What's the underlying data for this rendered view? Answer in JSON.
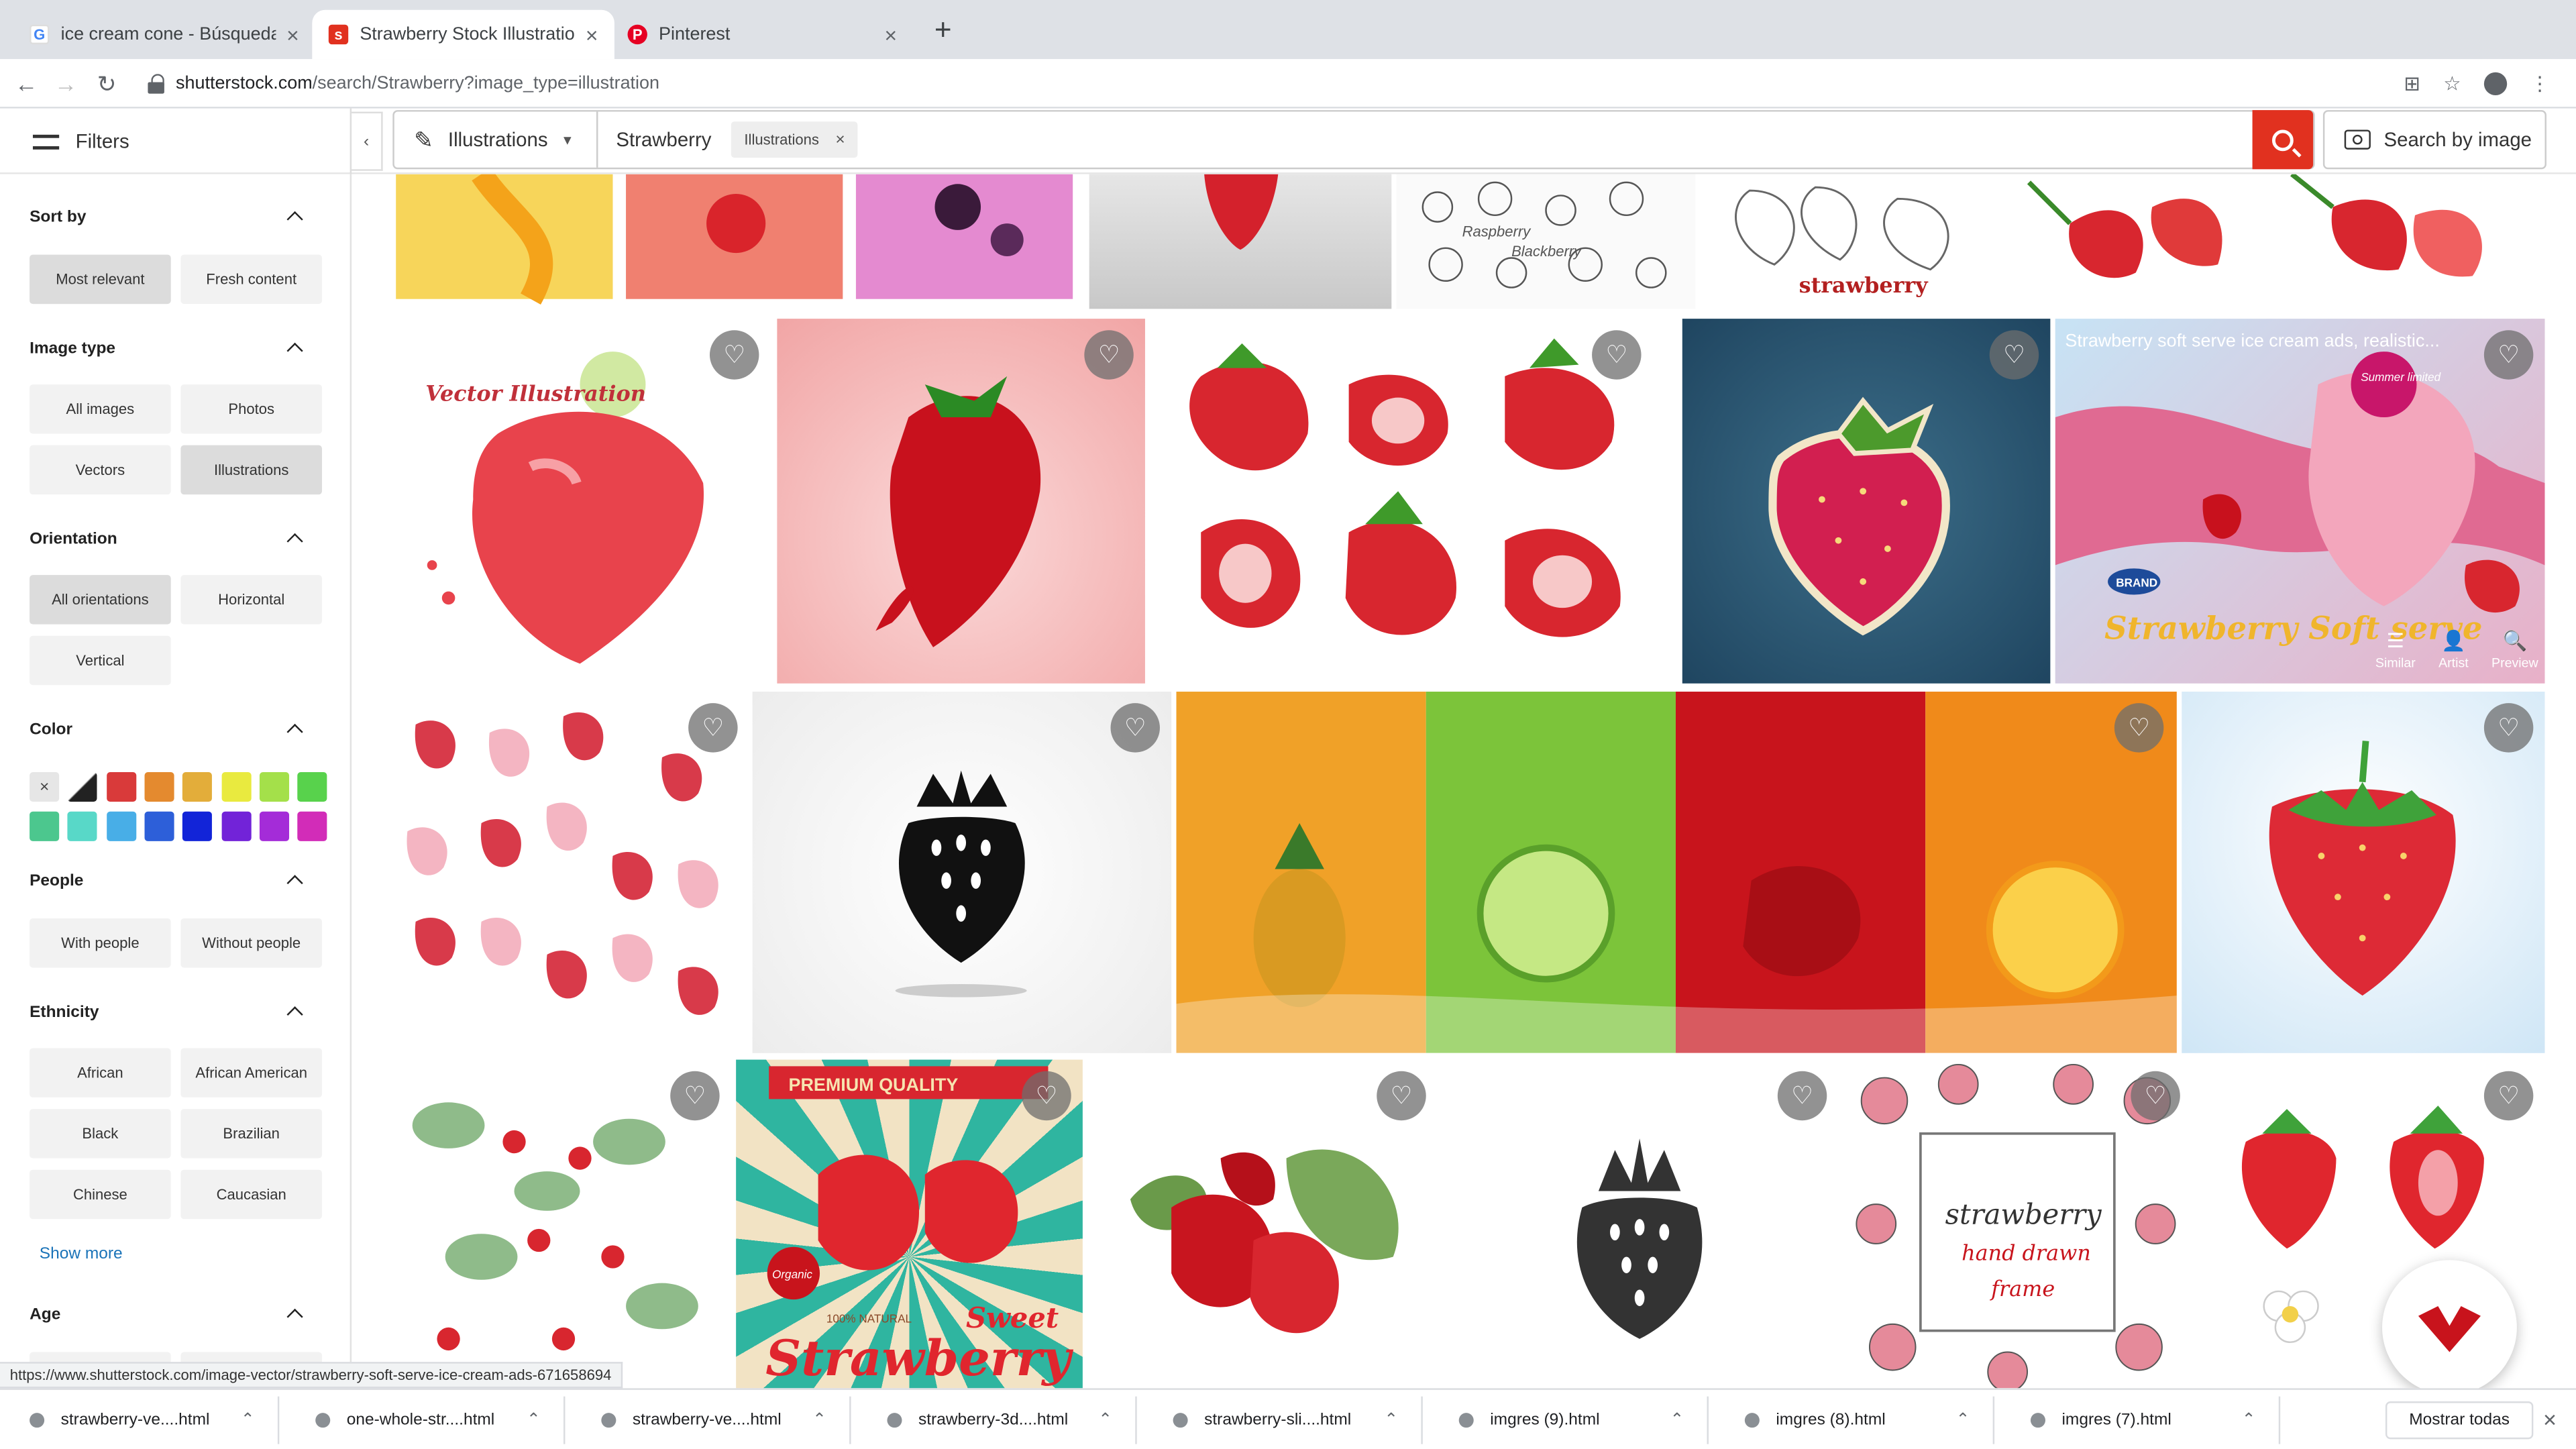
{
  "browser": {
    "tabs": [
      {
        "title": "ice cream cone - Búsqueda de",
        "icon": "google-icon"
      },
      {
        "title": "Strawberry Stock Illustrations,",
        "icon": "shutterstock-icon"
      },
      {
        "title": "Pinterest",
        "icon": "pinterest-icon"
      }
    ],
    "new_tab": "+",
    "url_host": "shutterstock.com",
    "url_path": "/search/Strawberry?image_type=illustration"
  },
  "header": {
    "filters_label": "Filters",
    "collapse": "‹",
    "image_type_select": "Illustrations",
    "query": "Strawberry",
    "chip_label": "Illustrations",
    "chip_remove": "×",
    "search_by_image": "Search by image"
  },
  "sidebar": {
    "sort_by": {
      "title": "Sort by",
      "options": [
        "Most relevant",
        "Fresh content"
      ],
      "selected": "Most relevant"
    },
    "image_type": {
      "title": "Image type",
      "options": [
        "All images",
        "Photos",
        "Vectors",
        "Illustrations"
      ],
      "selected": "Illustrations"
    },
    "orientation": {
      "title": "Orientation",
      "options": [
        "All orientations",
        "Horizontal",
        "Vertical"
      ],
      "selected": "All orientations"
    },
    "color": {
      "title": "Color",
      "clear": "×",
      "swatches": [
        "#e6e6e6",
        "#222222",
        "#d93a3a",
        "#e48a2f",
        "#e3ad3a",
        "#e9ea3f",
        "#a4e04a",
        "#58d24c",
        "#4cc78e",
        "#58d8c8",
        "#48aee7",
        "#2d5fd9",
        "#1224d8",
        "#7223d8",
        "#a42cd8",
        "#d22cb8"
      ]
    },
    "people": {
      "title": "People",
      "options": [
        "With people",
        "Without people"
      ]
    },
    "ethnicity": {
      "title": "Ethnicity",
      "options": [
        "African",
        "African American",
        "Black",
        "Brazilian",
        "Chinese",
        "Caucasian"
      ],
      "show_more": "Show more"
    },
    "age": {
      "title": "Age"
    }
  },
  "grid": {
    "hovered_title": "Strawberry soft serve ice cream ads, realistic...",
    "hover_actions": [
      "Similar",
      "Artist",
      "Preview"
    ],
    "favorite_glyph": "♡",
    "poster_texts": {
      "vector_illustration": "Vector Illustration",
      "summer_limited": "Summer limited",
      "brand": "BRAND",
      "strawberry_soft_serve": "Strawberry Soft serve",
      "premium_quality": "PREMIUM QUALITY",
      "organic": "Organic",
      "natural": "100% NATURAL",
      "sweet": "Sweet",
      "strawberry_big": "Strawberry",
      "frame_title": "strawberry",
      "frame_sub1": "hand drawn",
      "frame_sub2": "frame",
      "sketch_label": "strawberry",
      "raspberry": "Raspberry",
      "blackberry": "Blackberry"
    }
  },
  "status_url": "https://www.shutterstock.com/image-vector/strawberry-soft-serve-ice-cream-ads-671658694",
  "downloads": {
    "items": [
      "strawberry-ve....html",
      "one-whole-str....html",
      "strawberry-ve....html",
      "strawberry-3d....html",
      "strawberry-sli....html",
      "imgres (9).html",
      "imgres (8).html",
      "imgres (7).html"
    ],
    "show_all": "Mostrar todas",
    "close": "×"
  },
  "colors": {
    "brand_red": "#e1311f",
    "link_blue": "#1a73b8"
  }
}
